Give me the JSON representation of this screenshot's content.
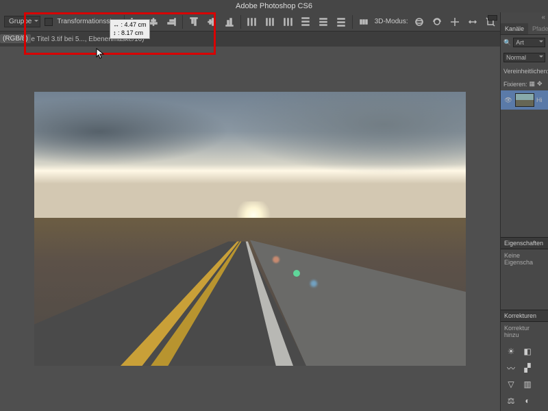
{
  "app_title": "Adobe Photoshop CS6",
  "options": {
    "group_label": "Gruppe",
    "colormode": "(RGB/8)",
    "transform_label": "Transformationsstrg.",
    "mode_3d": "3D-Modus:"
  },
  "tooltip": {
    "w": "↔ : 4.47 cm",
    "h": "↕ : 8.17 cm"
  },
  "doc_tab": {
    "close": "×",
    "name": "Ohne Titel 3.tif bei 5...",
    "suffix": ", Ebenenmaske/16) *"
  },
  "panels": {
    "channels_tab": "Kanäle",
    "paths_tab": "Pfade",
    "kind_label": "Art",
    "blend_mode": "Normal",
    "unify": "Vereinheitlichen:",
    "lock": "Fixieren:",
    "layer_name": "Hi",
    "properties": "Eigenschaften",
    "no_properties": "Keine Eigenscha",
    "corrections": "Korrekturen",
    "add_correction": "Korrektur hinzu"
  }
}
